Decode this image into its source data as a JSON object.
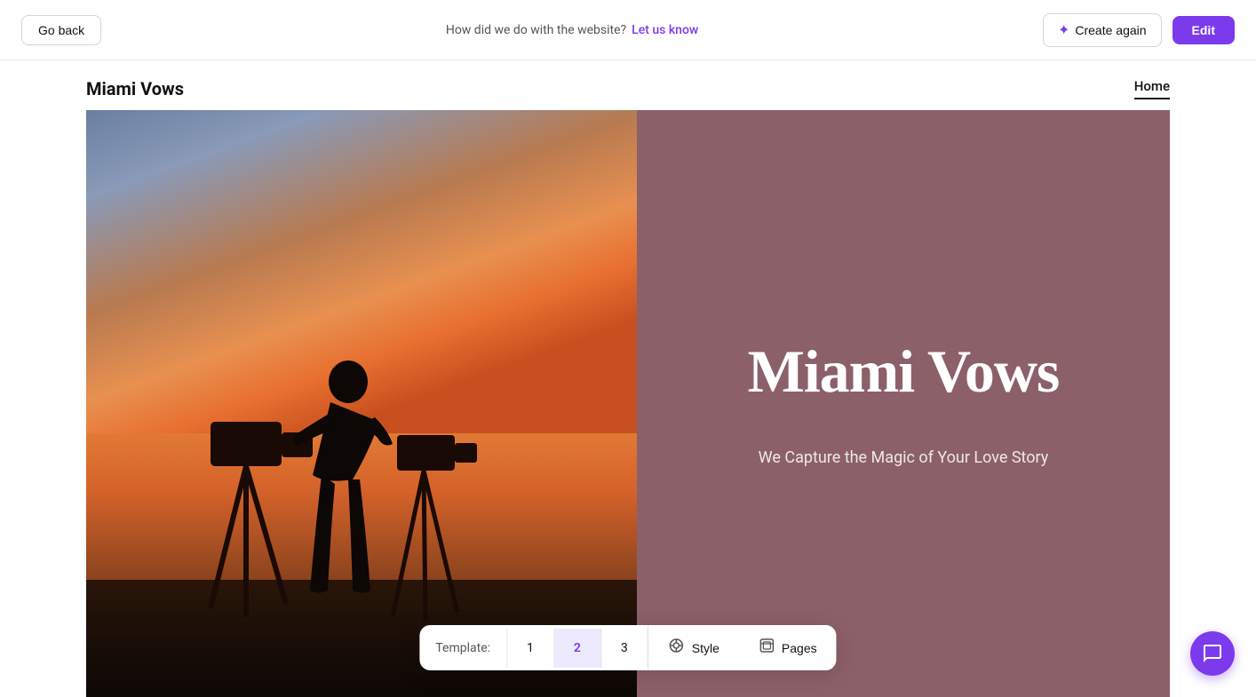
{
  "topbar": {
    "go_back_label": "Go back",
    "feedback_text": "How did we do with the website?",
    "feedback_link": "Let us know",
    "create_again_label": "Create again",
    "edit_label": "Edit"
  },
  "site_nav": {
    "title": "Miami Vows",
    "links": [
      {
        "label": "Home",
        "active": true
      }
    ]
  },
  "preview": {
    "overlay_title": "Miami Vows",
    "overlay_subtitle": "We Capture the Magic of Your Love Story"
  },
  "toolbar": {
    "template_label": "Template:",
    "templates": [
      "1",
      "2",
      "3"
    ],
    "active_template": "2",
    "style_label": "Style",
    "pages_label": "Pages"
  },
  "icons": {
    "create_again": "✦",
    "style": "◈",
    "pages": "≡",
    "chat": "💬"
  }
}
